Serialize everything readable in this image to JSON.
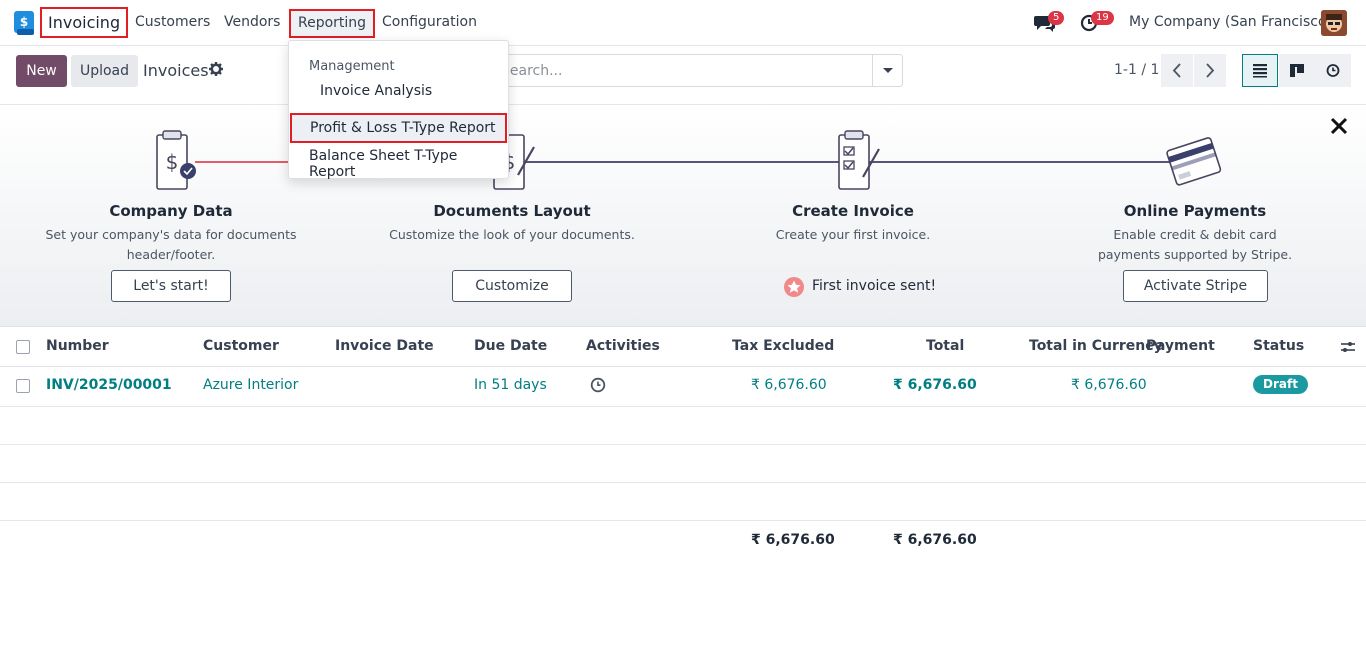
{
  "navbar": {
    "app_name": "Invoicing",
    "menu": [
      "Customers",
      "Vendors",
      "Reporting",
      "Configuration"
    ],
    "chat_badge": "5",
    "activity_badge": "19",
    "company": "My Company (San Francisco)"
  },
  "control_panel": {
    "new_label": "New",
    "upload_label": "Upload",
    "title": "Invoices",
    "search_placeholder": "Search...",
    "pager": "1-1 / 1"
  },
  "reporting_menu": {
    "section": "Management",
    "items": [
      "Invoice Analysis",
      "Profit & Loss T-Type Report",
      "Balance Sheet T-Type Report"
    ]
  },
  "onboarding": {
    "steps": [
      {
        "title": "Company Data",
        "desc": "Set your company's data for documents header/footer.",
        "button": "Let's start!"
      },
      {
        "title": "Documents Layout",
        "desc": "Customize the look of your documents.",
        "button": "Customize"
      },
      {
        "title": "Create Invoice",
        "desc": "Create your first invoice.",
        "done": "First invoice sent!"
      },
      {
        "title": "Online Payments",
        "desc": "Enable credit & debit card payments supported by Stripe.",
        "button": "Activate Stripe"
      }
    ]
  },
  "table": {
    "columns": [
      "Number",
      "Customer",
      "Invoice Date",
      "Due Date",
      "Activities",
      "Tax Excluded",
      "Total",
      "Total in Currency",
      "Payment",
      "Status"
    ],
    "rows": [
      {
        "number": "INV/2025/00001",
        "customer": "Azure Interior",
        "invoice_date": "",
        "due_date": "In 51 days",
        "tax_excluded": "₹ 6,676.60",
        "total": "₹ 6,676.60",
        "total_currency": "₹ 6,676.60",
        "payment": "",
        "status": "Draft"
      }
    ],
    "totals": {
      "tax_excluded": "₹ 6,676.60",
      "total": "₹ 6,676.60"
    }
  },
  "colors": {
    "brand": "#714b67",
    "accent": "#017e84",
    "highlight": "#e11d26"
  }
}
